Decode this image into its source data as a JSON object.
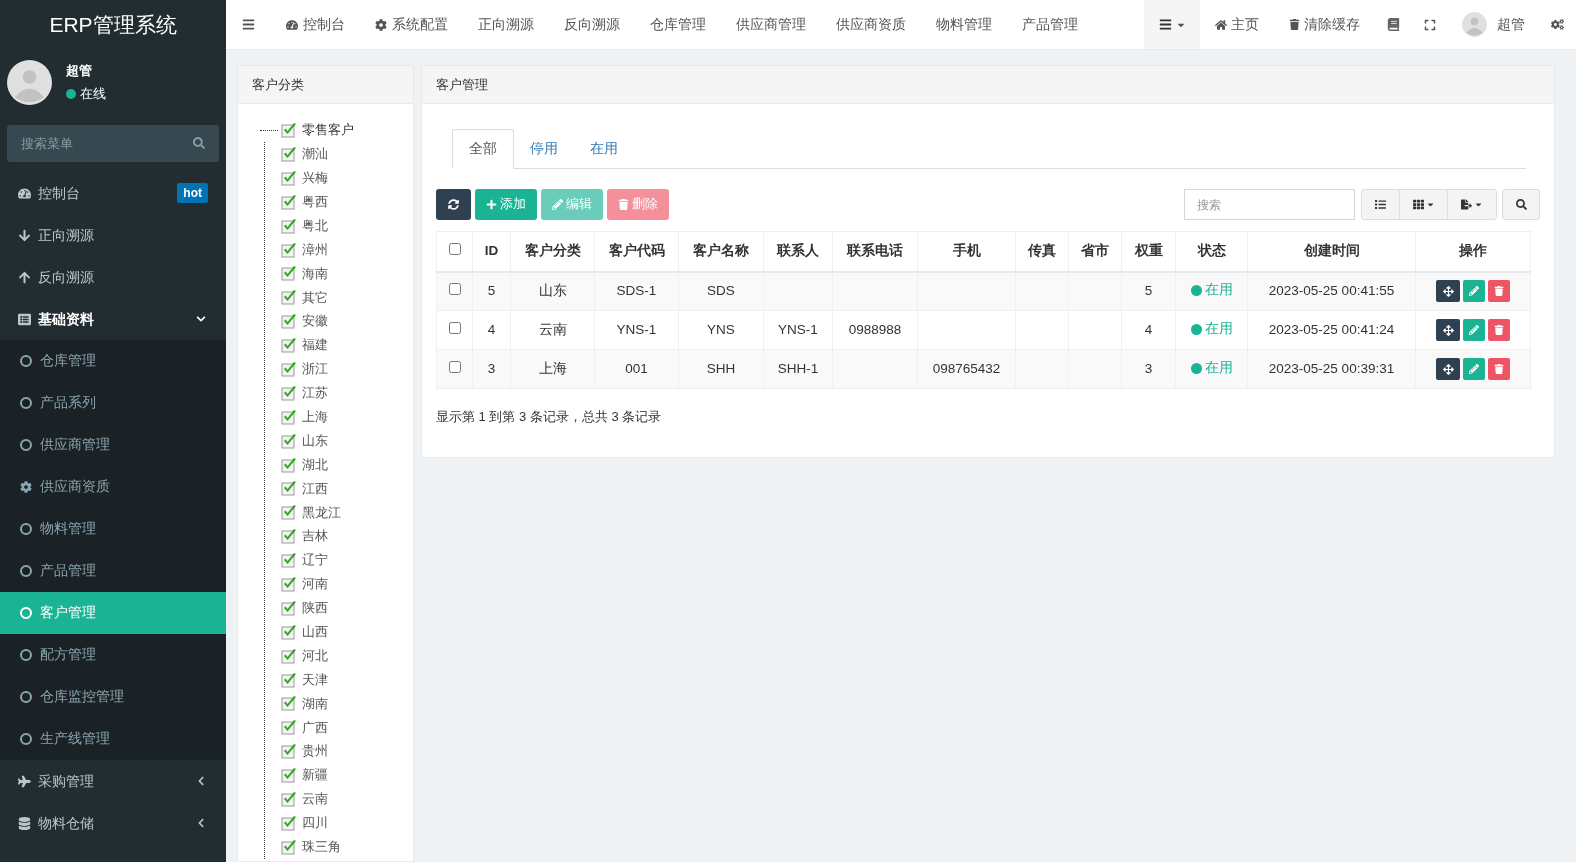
{
  "brand": "ERP管理系统",
  "user": {
    "name": "超管",
    "status": "在线",
    "online": true
  },
  "menu_search": {
    "placeholder": "搜索菜单"
  },
  "sidebar": {
    "items": [
      {
        "label": "控制台",
        "badge": "hot"
      },
      {
        "label": "正向溯源"
      },
      {
        "label": "反向溯源"
      },
      {
        "label": "基础资料",
        "expanded": true,
        "children": [
          {
            "label": "仓库管理",
            "selected": false
          },
          {
            "label": "产品系列",
            "selected": false
          },
          {
            "label": "供应商管理",
            "selected": false
          },
          {
            "label": "供应商资质",
            "selected": false
          },
          {
            "label": "物料管理",
            "selected": false
          },
          {
            "label": "产品管理",
            "selected": false
          },
          {
            "label": "客户管理",
            "selected": true
          },
          {
            "label": "配方管理",
            "selected": false
          },
          {
            "label": "仓库监控管理",
            "selected": false
          },
          {
            "label": "生产线管理",
            "selected": false
          }
        ]
      },
      {
        "label": "采购管理",
        "expanded": false
      },
      {
        "label": "物料仓储",
        "expanded": false
      }
    ]
  },
  "top_nav": {
    "tabs": [
      "控制台",
      "系统配置",
      "正向溯源",
      "反向溯源",
      "仓库管理",
      "供应商管理",
      "供应商资质",
      "物料管理",
      "产品管理"
    ],
    "right": {
      "home": "主页",
      "clear_cache": "清除缓存",
      "user": "超管"
    }
  },
  "category_panel": {
    "title": "客户分类",
    "tree": {
      "label": "零售客户",
      "checked": true,
      "expanded": true,
      "children": [
        {
          "label": "潮汕",
          "checked": true
        },
        {
          "label": "兴梅",
          "checked": true
        },
        {
          "label": "粤西",
          "checked": true
        },
        {
          "label": "粤北",
          "checked": true
        },
        {
          "label": "漳州",
          "checked": true
        },
        {
          "label": "海南",
          "checked": true
        },
        {
          "label": "其它",
          "checked": true
        },
        {
          "label": "安徽",
          "checked": true
        },
        {
          "label": "福建",
          "checked": true
        },
        {
          "label": "浙江",
          "checked": true
        },
        {
          "label": "江苏",
          "checked": true
        },
        {
          "label": "上海",
          "checked": true
        },
        {
          "label": "山东",
          "checked": true
        },
        {
          "label": "湖北",
          "checked": true
        },
        {
          "label": "江西",
          "checked": true
        },
        {
          "label": "黑龙江",
          "checked": true
        },
        {
          "label": "吉林",
          "checked": true
        },
        {
          "label": "辽宁",
          "checked": true
        },
        {
          "label": "河南",
          "checked": true
        },
        {
          "label": "陕西",
          "checked": true
        },
        {
          "label": "山西",
          "checked": true
        },
        {
          "label": "河北",
          "checked": true
        },
        {
          "label": "天津",
          "checked": true
        },
        {
          "label": "湖南",
          "checked": true
        },
        {
          "label": "广西",
          "checked": true
        },
        {
          "label": "贵州",
          "checked": true
        },
        {
          "label": "新疆",
          "checked": true
        },
        {
          "label": "云南",
          "checked": true
        },
        {
          "label": "四川",
          "checked": true
        },
        {
          "label": "珠三角",
          "checked": true
        }
      ]
    }
  },
  "customer_panel": {
    "title": "客户管理",
    "tabs": [
      {
        "label": "全部",
        "selected": true
      },
      {
        "label": "停用",
        "selected": false
      },
      {
        "label": "在用",
        "selected": false
      }
    ],
    "toolbar": [
      {
        "kind": "refresh",
        "disabled": false
      },
      {
        "kind": "add",
        "label": "添加",
        "disabled": false
      },
      {
        "kind": "edit",
        "label": "编辑",
        "disabled": true
      },
      {
        "kind": "delete",
        "label": "删除",
        "disabled": true
      }
    ],
    "search": {
      "placeholder": "搜索"
    },
    "table": {
      "select_all": false,
      "columns": [
        "ID",
        "客户分类",
        "客户代码",
        "客户名称",
        "联系人",
        "联系电话",
        "手机",
        "传真",
        "省市",
        "权重",
        "状态",
        "创建时间",
        "操作"
      ],
      "rows": [
        {
          "checked": false,
          "cells": [
            "5",
            "山东",
            "SDS-1",
            "SDS",
            "",
            "",
            "",
            "",
            "",
            "5"
          ],
          "status": {
            "text": "在用",
            "active": true
          },
          "created": "2023-05-25 00:41:55"
        },
        {
          "checked": false,
          "cells": [
            "4",
            "云南",
            "YNS-1",
            "YNS",
            "YNS-1",
            "0988988",
            "",
            "",
            "",
            "4"
          ],
          "status": {
            "text": "在用",
            "active": true
          },
          "created": "2023-05-25 00:41:24"
        },
        {
          "checked": false,
          "cells": [
            "3",
            "上海",
            "001",
            "SHH",
            "SHH-1",
            "",
            "098765432",
            "",
            "",
            "3"
          ],
          "status": {
            "text": "在用",
            "active": true
          },
          "created": "2023-05-25 00:39:31"
        }
      ]
    },
    "pagination": "显示第 1 到第 3 条记录，总共 3 条记录"
  }
}
